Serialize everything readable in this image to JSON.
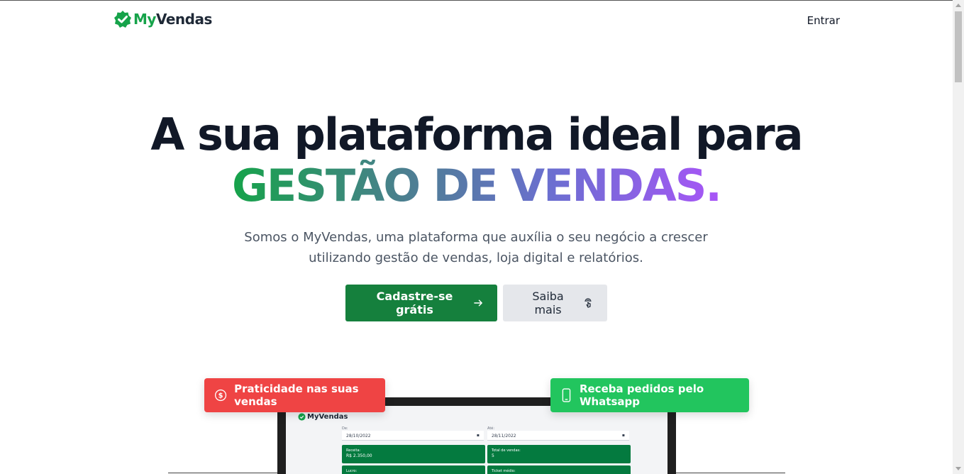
{
  "brand": {
    "prefix": "My",
    "suffix": "Vendas",
    "color": "#16a34a"
  },
  "nav": {
    "login_label": "Entrar"
  },
  "hero": {
    "line1": "A sua plataforma ideal para",
    "line2": "GESTÃO DE VENDAS.",
    "subtitle_line1": "Somos o MyVendas, uma plataforma que auxília o seu negócio a crescer",
    "subtitle_line2": "utilizando gestão de vendas, loja digital e relatórios.",
    "gradient_colors": [
      "#16a34a",
      "#4b7f8f",
      "#6b6fd0",
      "#a855f7"
    ]
  },
  "cta": {
    "primary_label": "Cadastre-se grátis",
    "primary_icon": "arrow-right-icon",
    "secondary_label": "Saiba mais",
    "secondary_icon": "pointer-click-icon"
  },
  "badges": {
    "left": {
      "label": "Praticidade nas suas vendas",
      "icon": "dollar-circle-icon",
      "color": "#ef4444"
    },
    "right": {
      "label": "Receba pedidos pelo Whatsapp",
      "icon": "smartphone-icon",
      "color": "#22c55e"
    }
  },
  "mockup": {
    "logo": "MyVendas",
    "from_label": "De:",
    "to_label": "Até:",
    "from_date": "28/10/2022",
    "to_date": "28/11/2022",
    "cards": [
      {
        "label": "Receita:",
        "value": "R$ 2.350,00"
      },
      {
        "label": "Total de vendas:",
        "value": "5"
      },
      {
        "label": "Lucro:",
        "value": ""
      },
      {
        "label": "Ticket médio:",
        "value": ""
      }
    ]
  }
}
